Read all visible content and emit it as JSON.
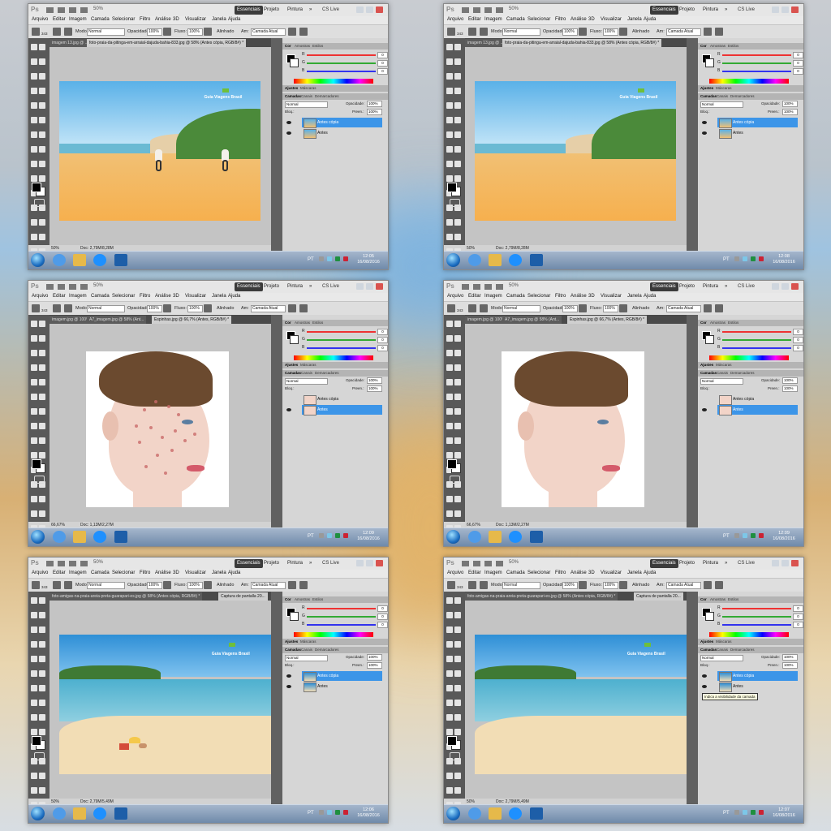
{
  "appbar": {
    "app_logo": "Ps",
    "zoom": "50%",
    "workspaces": [
      "Essenciais",
      "Projeto",
      "Pintura"
    ],
    "overflow": "»",
    "cslive": "CS Live"
  },
  "menu": [
    "Arquivo",
    "Editar",
    "Imagem",
    "Camada",
    "Selecionar",
    "Filtro",
    "Análise",
    "3D",
    "Visualizar",
    "Janela",
    "Ajuda"
  ],
  "options": {
    "brush_size": "343",
    "mode_label": "Modo:",
    "mode_value": "Normal",
    "opacity_label": "Opacidade:",
    "opacity_value": "100%",
    "flow_label": "Fluxo:",
    "flow_value": "100%",
    "aligned": "Alinhado",
    "sample_label": "Am:",
    "sample_value": "Camada Atual"
  },
  "colors": {
    "accent": "#3c95e8",
    "toolbox_bg": "#595959",
    "canvas_bg": "#c4c4c4",
    "ps_panel_bg": "#d6d6d6",
    "taskbar_top": "#a5b6cc",
    "taskbar_bottom": "#6f8aaa",
    "essenciais_bg": "#3b3b3b",
    "bg_gray": "#c9ccd1",
    "bg_sky": "#9fc3e0",
    "bg_sand": "#d8b074",
    "bg_light": "#e9d6b0",
    "bg_blue": "#7fb3dd",
    "bg_gold": "#e1b36a",
    "sky": "#5ab1e8",
    "sea": "#6bbad3",
    "sand": "#f1c074",
    "hill": "#4b8a3a",
    "cliff": "#e6cfa8",
    "beach2_sky": "#2e8fd6",
    "beach2_sea": "#4db0cf",
    "beach2_sand": "#f2ddb5",
    "vegetation": "#3f7a34",
    "skin": "#f2d4c8",
    "hair": "#6b4a2f",
    "blemish": "#c96a6a",
    "lips": "#d45a6a",
    "eye": "#5a7da0",
    "bicycle": "#333333",
    "rider": "#f4f0ea",
    "chair": "#d44c3a",
    "umbrella": "#f5c84a",
    "win_close": "#d9534f",
    "win_btn": "#cfd6de",
    "chrome": "#1e90ff",
    "ps_icon": "#1d5ea8",
    "explorer": "#e6b94a",
    "ie": "#4f9be8",
    "logo_green": "#6fbf3a",
    "red": "#e33",
    "green": "#3a3",
    "blue": "#33e",
    "lang": "#f4f4f4",
    "tray1": "#7dc7e8",
    "tray2": "#c23",
    "tray3": "#1f8f3f",
    "tray4": "#999999"
  },
  "panels": {
    "color_tabs": [
      "Cor",
      "Amostras",
      "Estilos"
    ],
    "slider_labels": [
      "R",
      "G",
      "B"
    ],
    "slider_value": "0",
    "adj_tabs": [
      "Ajustes",
      "Máscaras"
    ],
    "layer_tabs": [
      "Camadas",
      "Canais",
      "Demarcadores"
    ],
    "blend_mode": "Normal",
    "opacity_label": "Opacidade:",
    "opacity_value": "100%",
    "lock_label": "Bloq.:",
    "fill_label": "Preen.:",
    "fill_value": "100%"
  },
  "tooltip": "Indica a visibilidade da camada",
  "windows": [
    {
      "tabs": [
        "imagem 13.jpg @ ...",
        "foto-praia-da-pitinga-em-arraial-dajuda-bahia-833.jpg @ 58% (Antes cópia, RGB/8#) *"
      ],
      "status_zoom": "50%",
      "status_doc": "Doc: 2,79M/8,28M",
      "layers": [
        {
          "name": "Antes cópia",
          "selected": true
        },
        {
          "name": "Antes",
          "selected": false
        }
      ],
      "time": "12:05",
      "date": "16/08/2016"
    },
    {
      "tabs": [
        "imagem 13.jpg @ ...",
        "foto-praia-da-pitinga-em-arraial-dajuda-bahia-833.jpg @ 58% (Antes cópia, RGB/8#) *"
      ],
      "status_zoom": "50%",
      "status_doc": "Doc: 2,79M/8,28M",
      "layers": [
        {
          "name": "Antes cópia",
          "selected": true
        },
        {
          "name": "Antes",
          "selected": false
        }
      ],
      "time": "12:08",
      "date": "16/08/2016"
    },
    {
      "tabs": [
        "imagem.jpg @ 100% (Anti...",
        "A7_imagem.jpg @ 58% (Ant...",
        "Espinhas.jpg @ 66,7% (Antes, RGB/8#) *"
      ],
      "status_zoom": "66,67%",
      "status_doc": "Doc: 1,13M/2,27M",
      "layers": [
        {
          "name": "Antes cópia",
          "selected": false
        },
        {
          "name": "Antes",
          "selected": true
        }
      ],
      "time": "12:09",
      "date": "16/08/2016"
    },
    {
      "tabs": [
        "imagem.jpg @ 100% (Anti...",
        "A7_imagem.jpg @ 58% (Ant...",
        "Espinhas.jpg @ 66,7% (Antes, RGB/8#) *"
      ],
      "status_zoom": "66,67%",
      "status_doc": "Doc: 1,13M/2,27M",
      "layers": [
        {
          "name": "Antes cópia",
          "selected": false
        },
        {
          "name": "Antes",
          "selected": true
        }
      ],
      "time": "12:09",
      "date": "16/08/2016"
    },
    {
      "tabs": [
        "foto-amigas-na-praia-areia-preta-guarapari-es.jpg @ 58% (Antes cópia, RGB/8#) *",
        "Captura de pantalla 20..."
      ],
      "status_zoom": "50%",
      "status_doc": "Doc: 2,79M/5,49M",
      "layers": [
        {
          "name": "Antes cópia",
          "selected": true
        },
        {
          "name": "Antes",
          "selected": false
        }
      ],
      "time": "12:06",
      "date": "16/08/2016"
    },
    {
      "tabs": [
        "foto-amigas-na-praia-areia-preta-guarapari-es.jpg @ 58% (Antes cópia, RGB/8#) *",
        "Captura de pantalla 20..."
      ],
      "status_zoom": "50%",
      "status_doc": "Doc: 2,79M/5,49M",
      "layers": [
        {
          "name": "Antes cópia",
          "selected": true
        },
        {
          "name": "Antes",
          "selected": false
        }
      ],
      "time": "12:07",
      "date": "16/08/2016"
    }
  ],
  "watermark": "Guia Viagens Brasil",
  "tray_lang": "PT"
}
